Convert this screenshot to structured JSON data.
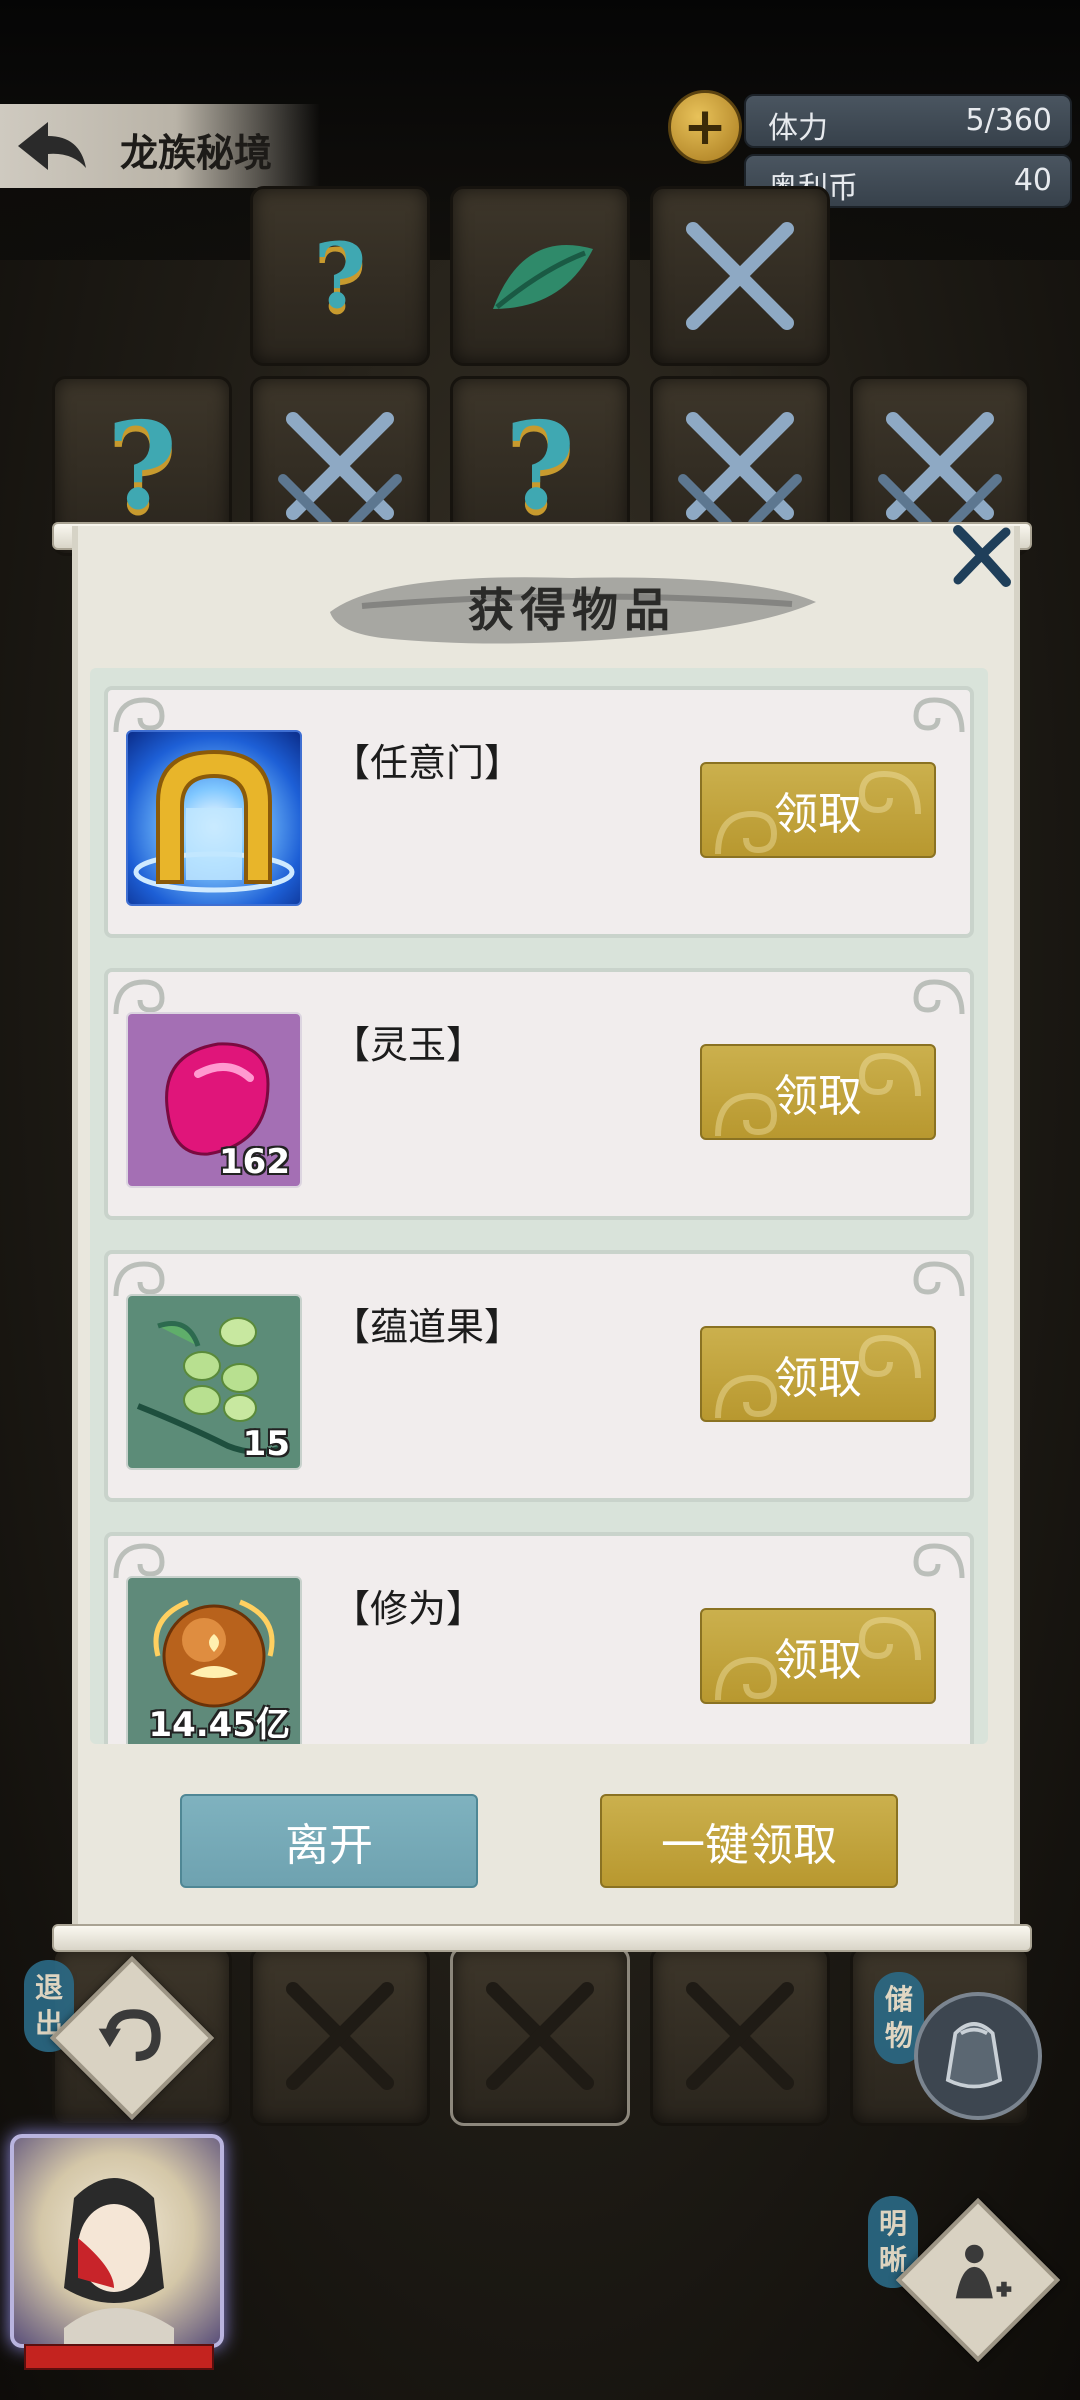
{
  "header": {
    "title": "龙族秘境",
    "resources": [
      {
        "label": "体力",
        "value": "5/360"
      },
      {
        "label": "奥利币",
        "value": "40"
      }
    ]
  },
  "dialog": {
    "title": "获得物品",
    "items": [
      {
        "name": "【任意门】",
        "quantity": "",
        "icon": "golden-gate-icon",
        "button": "领取"
      },
      {
        "name": "【灵玉】",
        "quantity": "162",
        "icon": "pink-jade-icon",
        "button": "领取"
      },
      {
        "name": "【蕴道果】",
        "quantity": "15",
        "icon": "green-fruit-branch-icon",
        "button": "领取"
      },
      {
        "name": "【修为】",
        "quantity": "14.45亿",
        "icon": "cultivation-orb-icon",
        "button": "领取"
      }
    ],
    "leave_button": "离开",
    "claim_all_button": "一键领取"
  },
  "hud": {
    "exit_label": "退出",
    "storage_label": "储物",
    "clear_label": "明晰"
  },
  "colors": {
    "gold_button": "#c0a23c",
    "teal_button": "#77abb8",
    "panel_bg": "#e9e7dd",
    "item_bg": "#f1eded"
  }
}
